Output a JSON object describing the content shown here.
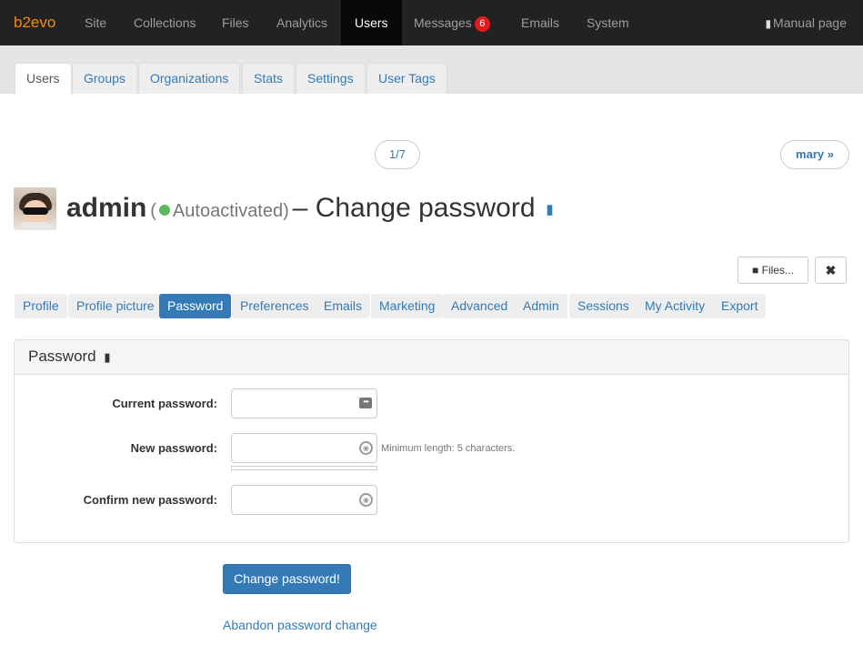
{
  "topnav": {
    "brand": "b2evo",
    "items": [
      "Site",
      "Collections",
      "Files",
      "Analytics",
      "Users",
      "Messages",
      "Emails",
      "System"
    ],
    "messages_badge": "6",
    "manual": "Manual page"
  },
  "subtabs": [
    "Users",
    "Groups",
    "Organizations",
    "Stats",
    "Settings",
    "User Tags"
  ],
  "pager": {
    "count": "1/7",
    "next": "mary »"
  },
  "page": {
    "username": "admin",
    "status_open": "(",
    "status": "Autoactivated)",
    "title_rest": "– Change password"
  },
  "actions": {
    "files": "Files...",
    "close": "✖"
  },
  "user_tabs": [
    "Profile",
    "Profile picture",
    "Password",
    "Preferences",
    "Emails",
    "Marketing",
    "Advanced",
    "Admin",
    "Sessions",
    "My Activity",
    "Export"
  ],
  "panel": {
    "title": "Password",
    "current_label": "Current password:",
    "new_label": "New password:",
    "new_hint": "Minimum length: 5 characters.",
    "confirm_label": "Confirm new password:",
    "current_value": "",
    "new_value": "",
    "confirm_value": ""
  },
  "buttons": {
    "submit": "Change password!",
    "abandon": "Abandon password change"
  },
  "colors": {
    "accent": "#337ab7",
    "brand": "#f38b0c",
    "status_ok": "#5cb85c",
    "badge": "#e6191b"
  }
}
